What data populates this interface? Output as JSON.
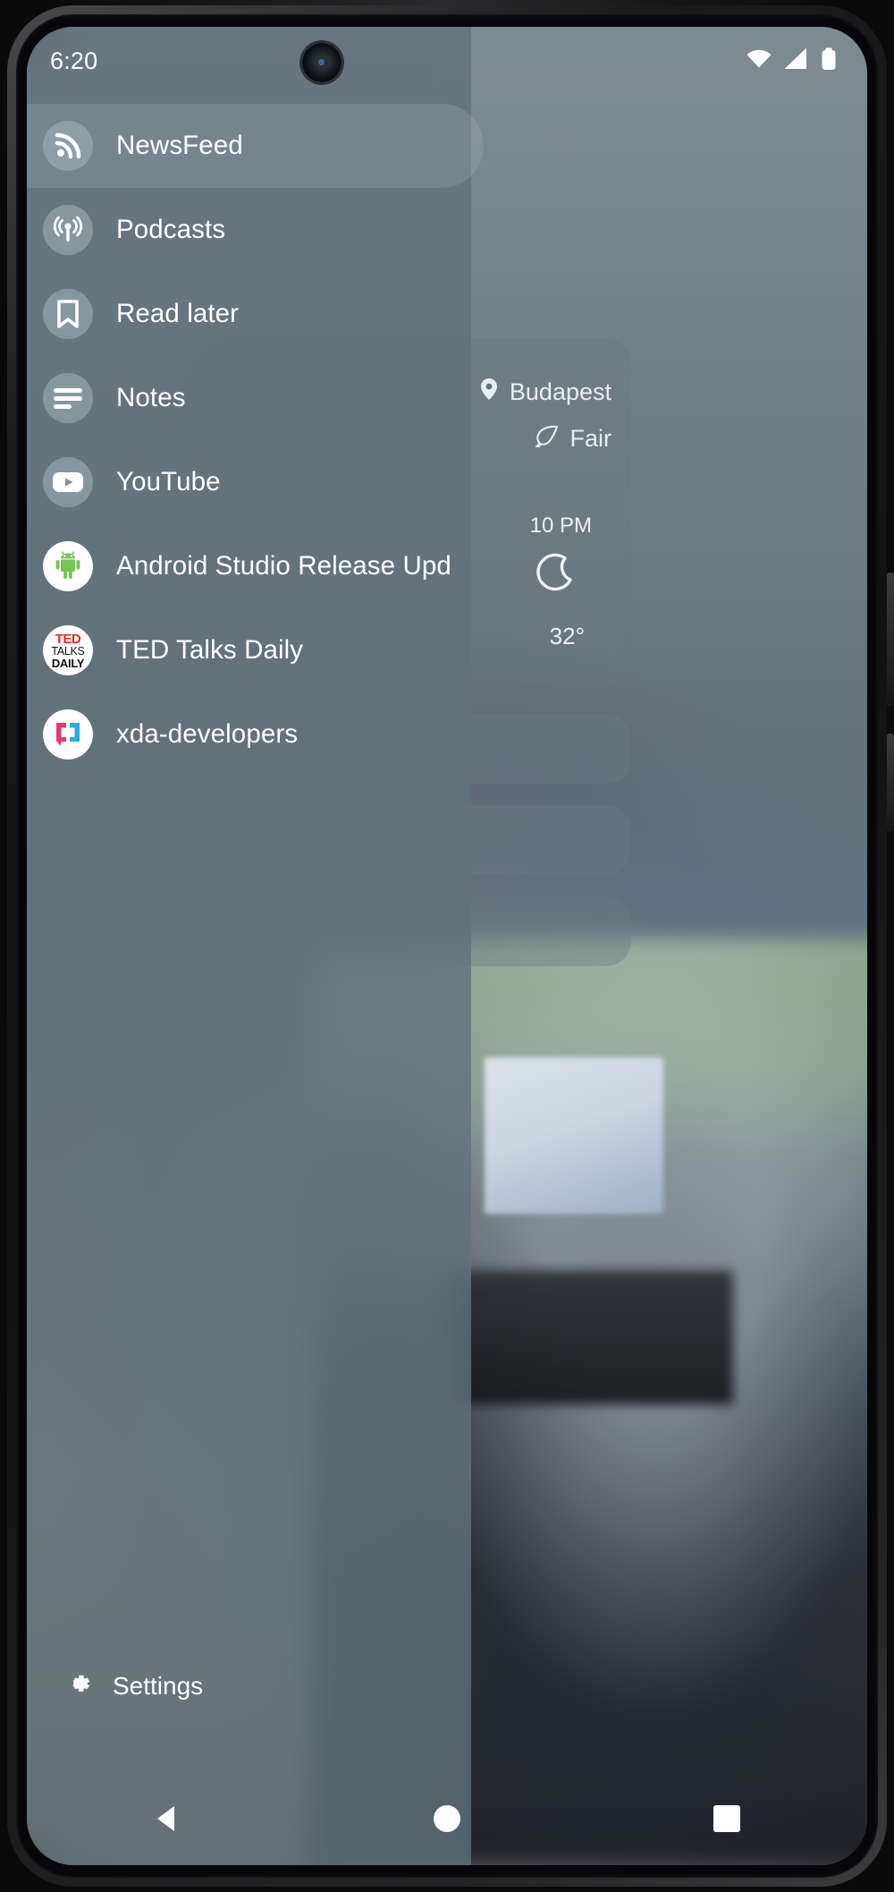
{
  "status_bar": {
    "time": "6:20",
    "icons": [
      "wifi-icon",
      "signal-icon",
      "battery-icon"
    ]
  },
  "drawer": {
    "items": [
      {
        "label": "NewsFeed",
        "icon": "rss-icon",
        "selected": true
      },
      {
        "label": "Podcasts",
        "icon": "podcast-icon",
        "selected": false
      },
      {
        "label": "Read later",
        "icon": "bookmark-icon",
        "selected": false
      },
      {
        "label": "Notes",
        "icon": "notes-lines-icon",
        "selected": false
      },
      {
        "label": "YouTube",
        "icon": "youtube-icon",
        "selected": false
      },
      {
        "label": "Android Studio Release Upd",
        "icon": "android-icon",
        "selected": false
      },
      {
        "label": "TED Talks Daily",
        "icon": "ted-talks-icon",
        "selected": false
      },
      {
        "label": "xda-developers",
        "icon": "xda-developers-icon",
        "selected": false
      }
    ],
    "footer": {
      "label": "Settings",
      "icon": "gear-icon"
    }
  },
  "ted_logo": {
    "line1": "TED",
    "line2": "TALKS",
    "line3": "DAILY"
  },
  "weather_widget": {
    "location": "Budapest",
    "location_icon": "location-pin-icon",
    "condition": "Fair",
    "condition_icon": "leaf-icon",
    "time": "10 PM",
    "forecast_icon": "crescent-moon-icon",
    "temperature": "32°"
  },
  "nav_bar": {
    "back": "back-triangle-icon",
    "home": "home-circle-icon",
    "recents": "recents-square-icon"
  },
  "colors": {
    "drawer_bg": "#60727a",
    "selected_row": "#aabec6",
    "icon_circle": "#a0b4bc",
    "text": "#ffffff",
    "ted_red": "#e62b1e",
    "android_green": "#78c257",
    "xda_pink": "#e8376f",
    "xda_blue": "#2eaae2"
  }
}
